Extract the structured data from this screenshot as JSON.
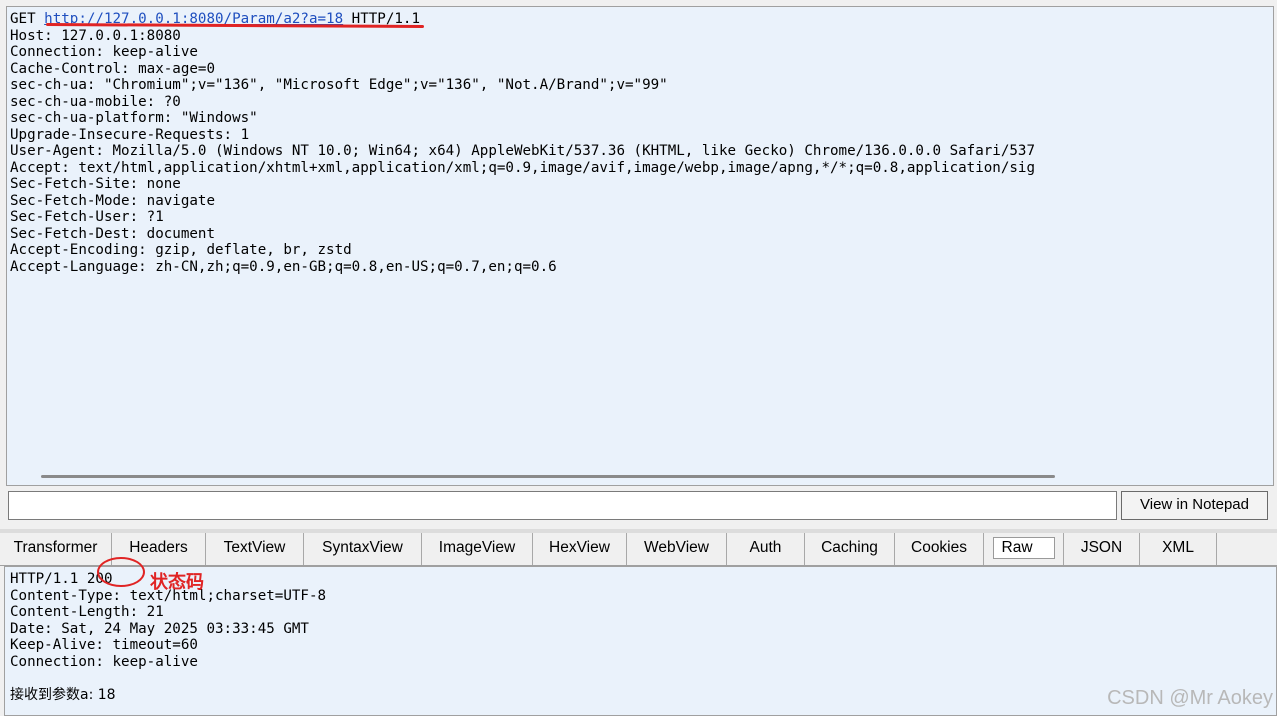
{
  "request": {
    "method": "GET ",
    "url": "http://127.0.0.1:8080/Param/a2?a=18",
    "protocol": " HTTP/1.1",
    "headers": [
      "Host: 127.0.0.1:8080",
      "Connection: keep-alive",
      "Cache-Control: max-age=0",
      "sec-ch-ua: \"Chromium\";v=\"136\", \"Microsoft Edge\";v=\"136\", \"Not.A/Brand\";v=\"99\"",
      "sec-ch-ua-mobile: ?0",
      "sec-ch-ua-platform: \"Windows\"",
      "Upgrade-Insecure-Requests: 1",
      "User-Agent: Mozilla/5.0 (Windows NT 10.0; Win64; x64) AppleWebKit/537.36 (KHTML, like Gecko) Chrome/136.0.0.0 Safari/537",
      "Accept: text/html,application/xhtml+xml,application/xml;q=0.9,image/avif,image/webp,image/apng,*/*;q=0.8,application/sig",
      "Sec-Fetch-Site: none",
      "Sec-Fetch-Mode: navigate",
      "Sec-Fetch-User: ?1",
      "Sec-Fetch-Dest: document",
      "Accept-Encoding: gzip, deflate, br, zstd",
      "Accept-Language: zh-CN,zh;q=0.9,en-GB;q=0.8,en-US;q=0.7,en;q=0.6"
    ]
  },
  "notes": {
    "input_value": "",
    "view_in_notepad": "View in Notepad"
  },
  "tabs": [
    "Transformer",
    "Headers",
    "TextView",
    "SyntaxView",
    "ImageView",
    "HexView",
    "WebView",
    "Auth",
    "Caching",
    "Cookies",
    "Raw",
    "JSON",
    "XML"
  ],
  "active_tab": "Raw",
  "response": {
    "status_prefix": "HTTP/1.1 ",
    "status_code": "200",
    "headers": [
      "Content-Type: text/html;charset=UTF-8",
      "Content-Length: 21",
      "Date: Sat, 24 May 2025 03:33:45 GMT",
      "Keep-Alive: timeout=60",
      "Connection: keep-alive"
    ],
    "body": "接收到参数a: 18"
  },
  "annotation": {
    "status_label": "状态码",
    "color": "#e02424"
  },
  "watermark": "CSDN @Mr  Aokey"
}
